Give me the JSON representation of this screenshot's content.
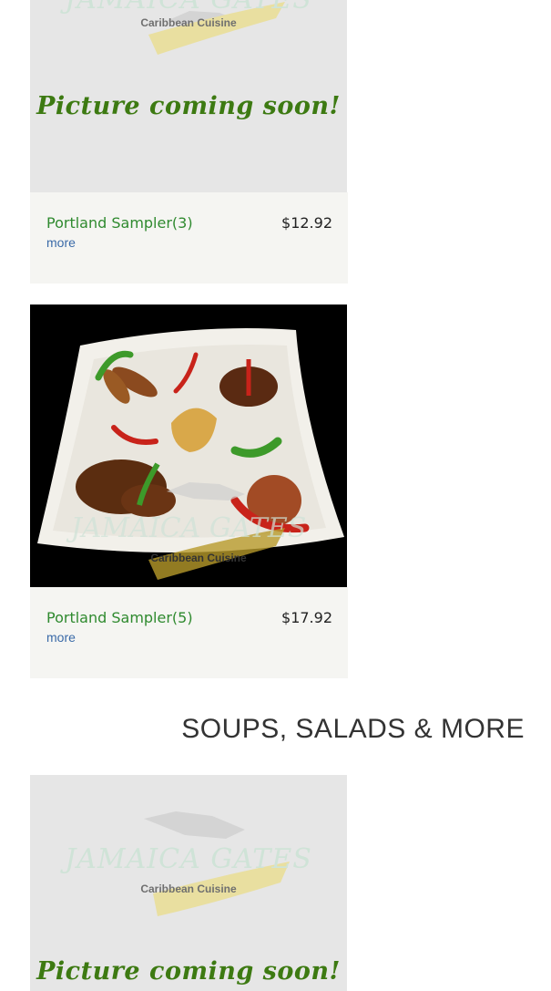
{
  "placeholder": {
    "text": "Picture coming soon!",
    "logo_text": "JAMAICA GATES",
    "logo_subtitle": "Caribbean Cuisine"
  },
  "items": [
    {
      "name": "Portland Sampler(3)",
      "price": "$12.92",
      "more": "more"
    },
    {
      "name": "Portland Sampler(5)",
      "price": "$17.92",
      "more": "more"
    }
  ],
  "section": {
    "title": "SOUPS, SALADS & MORE"
  },
  "colors": {
    "item_name": "#2f8a2f",
    "placeholder_text": "#3d7a12",
    "card_info_bg": "#f5f5f2",
    "more_link": "#3a6aa8"
  }
}
